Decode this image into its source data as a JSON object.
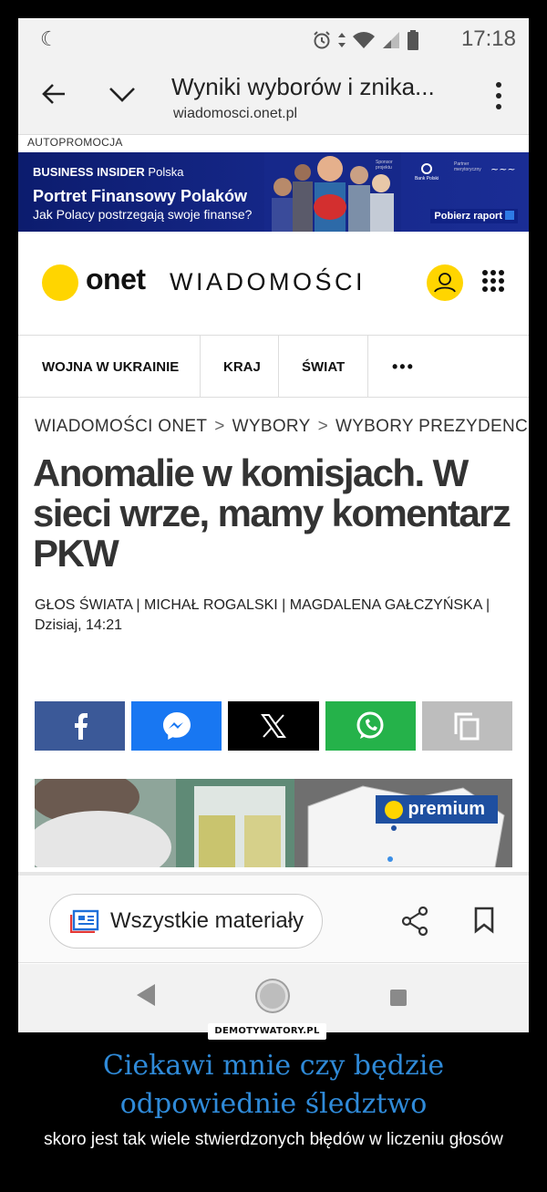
{
  "status_bar": {
    "time": "17:18"
  },
  "browser": {
    "page_title": "Wyniki wyborów i znika...",
    "host": "wiadomosci.onet.pl"
  },
  "ad": {
    "label": "AUTOPROMOCJA",
    "brand_bold": "BUSINESS INSIDER",
    "brand_rest": " Polska",
    "title": "Portret Finansowy Polaków",
    "subtitle": "Jak Polacy postrzegają swoje finanse?",
    "sponsor": "Sponsor projektu",
    "bank": "Bank Polski",
    "partner": "Partner merytoryczny",
    "cta": "Pobierz raport"
  },
  "site": {
    "logo_word": "onet",
    "section": "WIADOMOŚCI"
  },
  "nav": {
    "items": [
      "WOJNA W UKRAINIE",
      "KRAJ",
      "ŚWIAT"
    ],
    "more": "•••"
  },
  "breadcrumb": [
    "WIADOMOŚCI ONET",
    "WYBORY",
    "WYBORY PREZYDENC"
  ],
  "article": {
    "headline": "Anomalie w komisjach. W sieci wrze, mamy komentarz PKW",
    "authors": "GŁOS ŚWIATA | MICHAŁ ROGALSKI | MAGDALENA GAŁCZYŃSKA |",
    "date": "Dzisiaj, 14:21"
  },
  "share": [
    {
      "name": "facebook",
      "color": "#3b5998"
    },
    {
      "name": "messenger",
      "color": "#1877f2"
    },
    {
      "name": "x",
      "color": "#000000"
    },
    {
      "name": "whatsapp",
      "color": "#25b24a"
    },
    {
      "name": "copy",
      "color": "#bdbdbd"
    }
  ],
  "hero": {
    "badge": "premium"
  },
  "toolbar": {
    "all_materials": "Wszystkie materiały"
  },
  "watermark": "DEMOTYWATORY.PL",
  "caption": {
    "title": "Ciekawi mnie czy będzie odpowiednie śledztwo",
    "subtitle": "skoro jest tak wiele stwierdzonych błędów w liczeniu głosów"
  },
  "colors": {
    "accent_yellow": "#ffd500",
    "ad_blue": "#16288a",
    "caption_blue": "#2f8ad8"
  }
}
